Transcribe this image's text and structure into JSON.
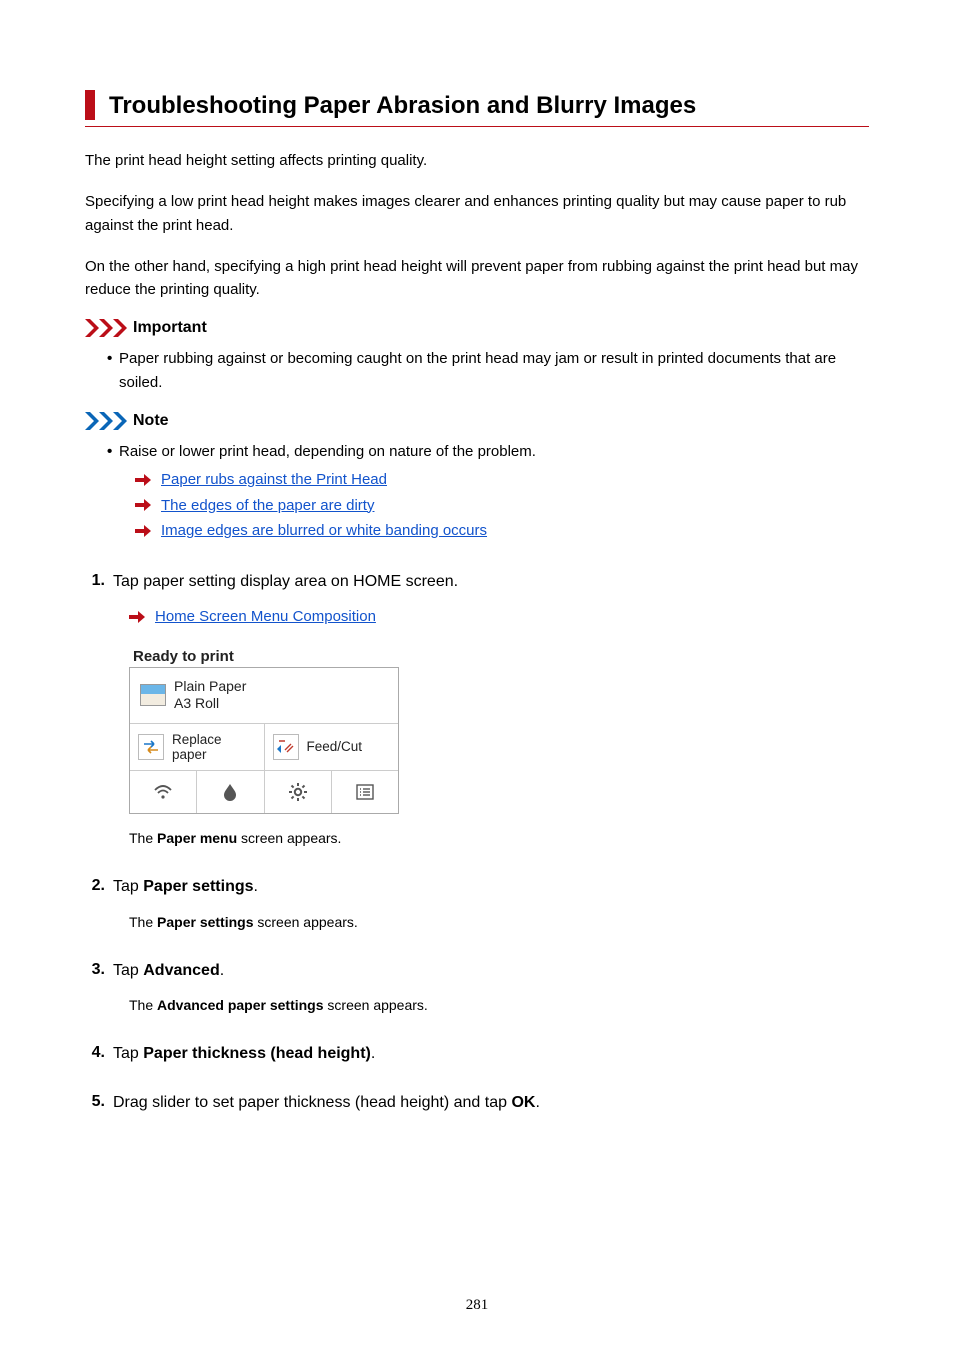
{
  "title": "Troubleshooting Paper Abrasion and Blurry Images",
  "intro": [
    "The print head height setting affects printing quality.",
    "Specifying a low print head height makes images clearer and enhances printing quality but may cause paper to rub against the print head.",
    "On the other hand, specifying a high print head height will prevent paper from rubbing against the print head but may reduce the printing quality."
  ],
  "important": {
    "label": "Important",
    "bullet": "Paper rubbing against or becoming caught on the print head may jam or result in printed documents that are soiled."
  },
  "note": {
    "label": "Note",
    "bullet": "Raise or lower print head, depending on nature of the problem.",
    "links": [
      "Paper rubs against the Print Head",
      "The edges of the paper are dirty",
      "Image edges are blurred or white banding occurs"
    ]
  },
  "steps": {
    "s1": {
      "num": "1.",
      "text_before": "Tap paper setting display area on HOME screen.",
      "link": "Home Screen Menu Composition",
      "screenshot": {
        "status": "Ready to print",
        "paper1": "Plain Paper",
        "paper2": "A3 Roll",
        "replace1": "Replace",
        "replace2": "paper",
        "feedcut": "Feed/Cut"
      },
      "after_prefix": "The ",
      "after_bold": "Paper menu",
      "after_suffix": " screen appears."
    },
    "s2": {
      "num": "2.",
      "text_before": "Tap ",
      "text_bold": "Paper settings",
      "text_after": ".",
      "after_prefix": "The ",
      "after_bold": "Paper settings",
      "after_suffix": " screen appears."
    },
    "s3": {
      "num": "3.",
      "text_before": "Tap ",
      "text_bold": "Advanced",
      "text_after": ".",
      "after_prefix": "The ",
      "after_bold": "Advanced paper settings",
      "after_suffix": " screen appears."
    },
    "s4": {
      "num": "4.",
      "text_before": "Tap ",
      "text_bold": "Paper thickness (head height)",
      "text_after": "."
    },
    "s5": {
      "num": "5.",
      "text_before": "Drag slider to set paper thickness (head height) and tap ",
      "text_bold": "OK",
      "text_after": "."
    }
  },
  "page_number": "281"
}
